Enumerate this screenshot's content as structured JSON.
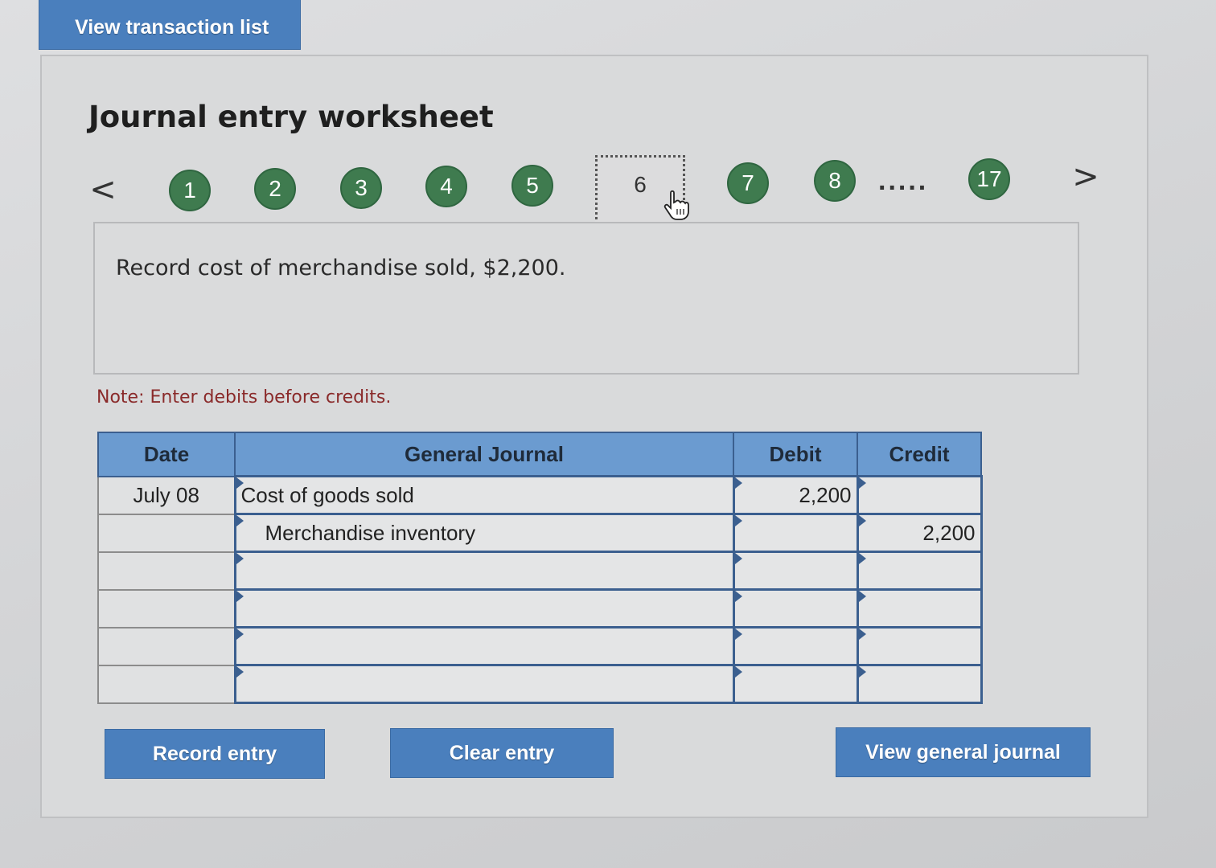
{
  "header": {
    "view_transaction_list_label": "View transaction list"
  },
  "worksheet": {
    "title": "Journal entry worksheet",
    "nav": {
      "prev_glyph": "<",
      "next_glyph": ">",
      "steps": [
        "1",
        "2",
        "3",
        "4",
        "5",
        "6",
        "7",
        "8",
        "17"
      ],
      "current_step": "6",
      "ellipsis": "....."
    },
    "description": "Record cost of merchandise sold, $2,200.",
    "note": "Note: Enter debits before credits."
  },
  "journal_table": {
    "headers": {
      "date": "Date",
      "general_journal": "General Journal",
      "debit": "Debit",
      "credit": "Credit"
    },
    "rows": [
      {
        "date": "July 08",
        "account": "Cost of goods sold",
        "debit": "2,200",
        "credit": ""
      },
      {
        "date": "",
        "account": "Merchandise inventory",
        "debit": "",
        "credit": "2,200"
      },
      {
        "date": "",
        "account": "",
        "debit": "",
        "credit": ""
      },
      {
        "date": "",
        "account": "",
        "debit": "",
        "credit": ""
      },
      {
        "date": "",
        "account": "",
        "debit": "",
        "credit": ""
      },
      {
        "date": "",
        "account": "",
        "debit": "",
        "credit": ""
      }
    ]
  },
  "actions": {
    "record_entry_label": "Record entry",
    "clear_entry_label": "Clear entry",
    "view_general_journal_label": "View general journal"
  },
  "colors": {
    "button_blue": "#4a7fbd",
    "step_green": "#3f7b4f",
    "header_blue": "#6b9bd0",
    "note_red": "#8a2a2a"
  },
  "icons": {
    "cursor": "hand-pointer-icon"
  }
}
